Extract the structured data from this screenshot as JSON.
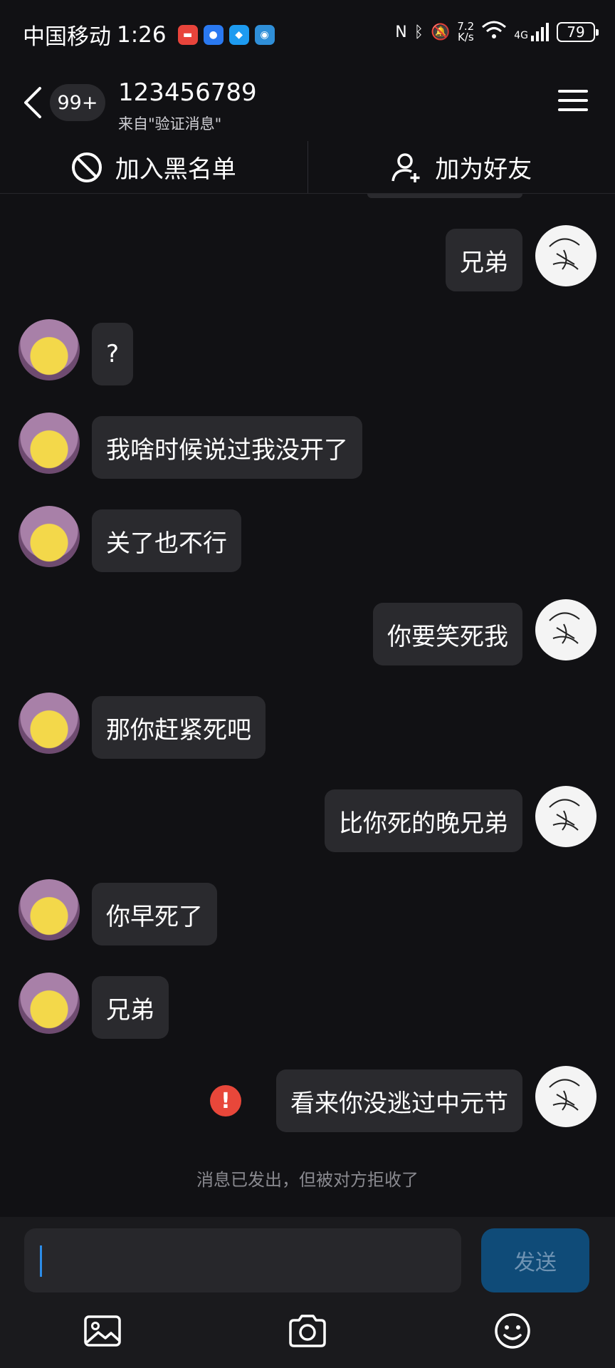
{
  "status_bar": {
    "carrier": "中国移动",
    "time": "1:26",
    "net_speed_value": "7.2",
    "net_speed_unit": "K/s",
    "signal_label": "4G",
    "battery": "79"
  },
  "header": {
    "unread_badge": "99+",
    "title": "123456789",
    "subtitle": "来自\"验证消息\""
  },
  "actions": {
    "block_label": "加入黑名单",
    "add_friend_label": "加为好友"
  },
  "messages": [
    {
      "side": "me",
      "text": "兄弟"
    },
    {
      "side": "other",
      "text": "?"
    },
    {
      "side": "other",
      "text": "我啥时候说过我没开了"
    },
    {
      "side": "other",
      "text": "关了也不行"
    },
    {
      "side": "me",
      "text": "你要笑死我"
    },
    {
      "side": "other",
      "text": "那你赶紧死吧"
    },
    {
      "side": "me",
      "text": "比你死的晚兄弟"
    },
    {
      "side": "other",
      "text": "你早死了"
    },
    {
      "side": "other",
      "text": "兄弟"
    },
    {
      "side": "me",
      "text": "看来你没逃过中元节",
      "failed": true
    }
  ],
  "notice": "消息已发出，但被对方拒收了",
  "input": {
    "value": "",
    "send_label": "发送"
  },
  "colors": {
    "background": "#111114",
    "bubble": "#2a2a2e",
    "send_button": "#0f4b78",
    "error": "#e8473a"
  }
}
